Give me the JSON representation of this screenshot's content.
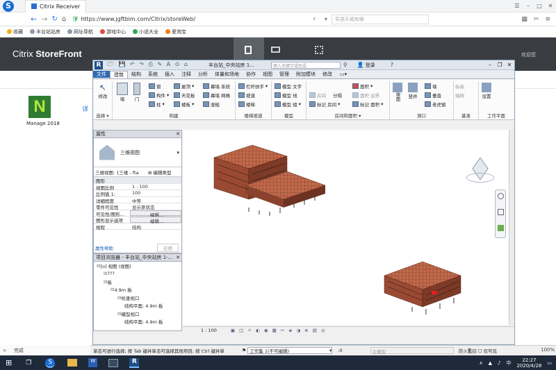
{
  "browser": {
    "tab_title": "Citrix Receiver",
    "url": "https://www.jgftbim.com/Citrix/storeWeb/",
    "search_placeholder": "导游天城有哪",
    "bookmarks": [
      "收藏",
      "丰台站站房",
      "网址导航",
      "游戏中心",
      "小说大全",
      "爱淘宝"
    ],
    "status": "完成",
    "zoom": "100%"
  },
  "storefront": {
    "brand_light": "Citrix ",
    "brand_bold": "StoreFront",
    "user": "欢迎您",
    "app_name": "Manage 2018",
    "app_hint": "详"
  },
  "revit": {
    "title": "丰台站_中央站房 1...",
    "search_placeholder": "键入关键字或短语",
    "login": "登录",
    "tabs": [
      "文件",
      "建筑",
      "结构",
      "系统",
      "插入",
      "注释",
      "分析",
      "体量和场地",
      "协作",
      "视图",
      "管理",
      "附加模块",
      "修改"
    ],
    "active_tab": 1,
    "groups": {
      "select": {
        "label": "选择 ▾",
        "modify": "修改"
      },
      "build": {
        "label": "构建",
        "items": [
          "墙",
          "门",
          "窗",
          "构件",
          "柱",
          "屋顶",
          "天花板",
          "楼板",
          "幕墙 系统",
          "幕墙 网格",
          "竖梃"
        ]
      },
      "circulation": {
        "label": "楼梯坡道",
        "items": [
          "栏杆扶手",
          "坡道",
          "楼梯"
        ]
      },
      "model": {
        "label": "模型",
        "items": [
          "模型 文字",
          "模型 线",
          "模型 组"
        ]
      },
      "room": {
        "label": "房间和面积 ▾",
        "items": [
          "房间",
          "分隔",
          "标记 房间",
          "面积",
          "面积 边界",
          "标记 面积"
        ]
      },
      "opening": {
        "label": "洞口",
        "items": [
          "按面",
          "竖井",
          "墙",
          "垂直",
          "老虎窗"
        ]
      },
      "datum": {
        "label": "基准",
        "items": [
          "标高",
          "轴网"
        ]
      },
      "workplane": {
        "label": "工作平面",
        "items": [
          "设置"
        ]
      }
    },
    "properties": {
      "header": "属性",
      "type": "三维视图",
      "selector": "三维视图: {三维 - fta",
      "edit_type": "编辑类型",
      "section": "图形",
      "rows": [
        {
          "k": "视图比例",
          "v": "1 : 100"
        },
        {
          "k": "比例值 1:",
          "v": "100"
        },
        {
          "k": "详细程度",
          "v": "中等"
        },
        {
          "k": "零件可见性",
          "v": "显示原状态"
        },
        {
          "k": "可见性/图形...",
          "v": "编辑..."
        },
        {
          "k": "图形显示选项",
          "v": "编辑..."
        },
        {
          "k": "规程",
          "v": "结构"
        }
      ],
      "help": "属性帮助",
      "apply": "应用"
    },
    "browser_panel": {
      "header": "项目浏览器 - 丰台站_中央站房 1-...",
      "items": [
        {
          "t": "[o] 视图 (视图)",
          "d": 0
        },
        {
          "t": "???",
          "d": 1
        },
        {
          "t": "板",
          "d": 1
        },
        {
          "t": "4.9m 板",
          "d": 2
        },
        {
          "t": "检查视口",
          "d": 3
        },
        {
          "t": "结构平面: 4.9m 板",
          "d": 4
        },
        {
          "t": "模型视口",
          "d": 3
        },
        {
          "t": "结构平面: 4.9m 板",
          "d": 4
        }
      ]
    },
    "view_scale": "1 : 100",
    "status": "单击可进行选择; 按 Tab 键并单击可选择其他项目; 按 Ctrl 键并单",
    "workset": "工作集 1(不可编辑)",
    "num": ":0",
    "model_label": "主模型",
    "readonly": "仅可见"
  },
  "taskbar": {
    "time": "22:27",
    "date": "2020/4/28",
    "tray_text": "防火监控"
  },
  "colors": {
    "sf_header": "#393d42",
    "accent": "#1a6bd6",
    "building": "#b85a3c"
  }
}
